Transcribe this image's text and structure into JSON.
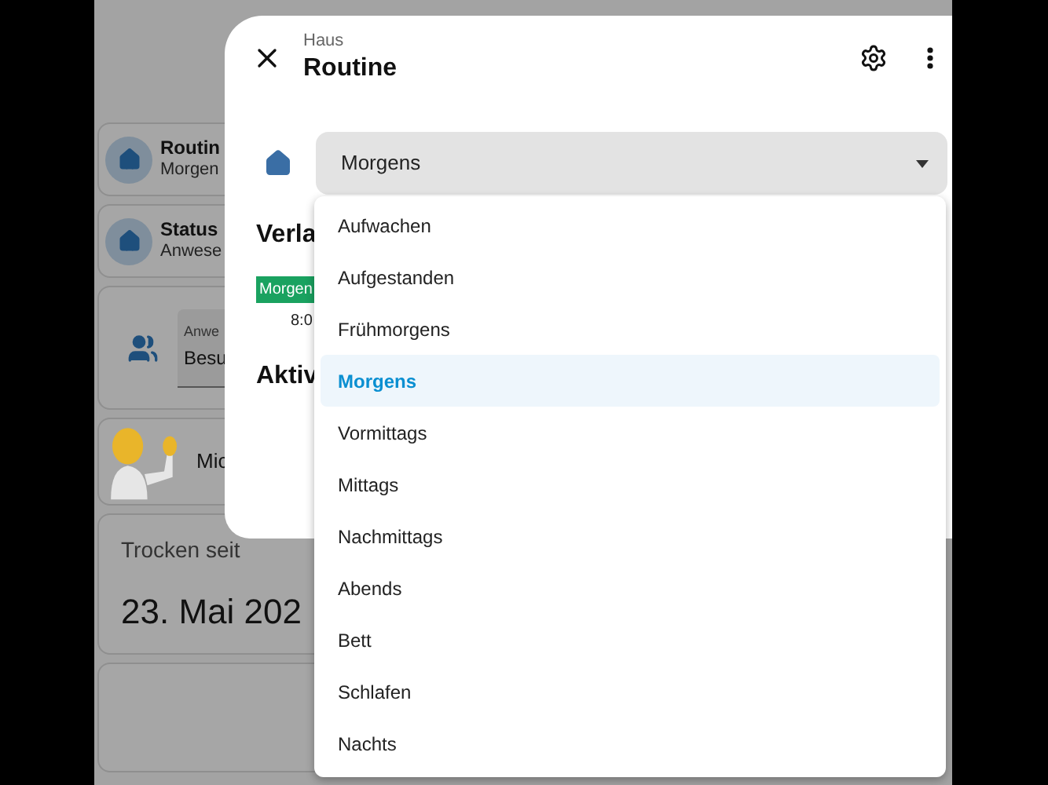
{
  "background": {
    "cards": [
      {
        "kind": "entity",
        "title": "Routin",
        "subtitle": "Morgen"
      },
      {
        "kind": "entity",
        "title": "Status",
        "subtitle": "Anwese"
      },
      {
        "kind": "select",
        "label": "Anwe",
        "value": "Besu"
      },
      {
        "kind": "person",
        "title": "Mic"
      },
      {
        "kind": "date",
        "title": "Trocken seit",
        "value": "23. Mai 202"
      },
      {
        "kind": "empty"
      }
    ]
  },
  "dialog": {
    "subtitle": "Haus",
    "title": "Routine",
    "select": {
      "value": "Morgens"
    },
    "history_heading": "Verla",
    "chip": {
      "label": "Morgen",
      "color": "#1aa260"
    },
    "time": "8:0",
    "activity_heading": "Aktiv"
  },
  "menu": {
    "items": [
      {
        "label": "Aufwachen",
        "selected": false
      },
      {
        "label": "Aufgestanden",
        "selected": false
      },
      {
        "label": "Frühmorgens",
        "selected": false
      },
      {
        "label": "Morgens",
        "selected": true
      },
      {
        "label": "Vormittags",
        "selected": false
      },
      {
        "label": "Mittags",
        "selected": false
      },
      {
        "label": "Nachmittags",
        "selected": false
      },
      {
        "label": "Abends",
        "selected": false
      },
      {
        "label": "Bett",
        "selected": false
      },
      {
        "label": "Schlafen",
        "selected": false
      },
      {
        "label": "Nachts",
        "selected": false
      }
    ]
  }
}
